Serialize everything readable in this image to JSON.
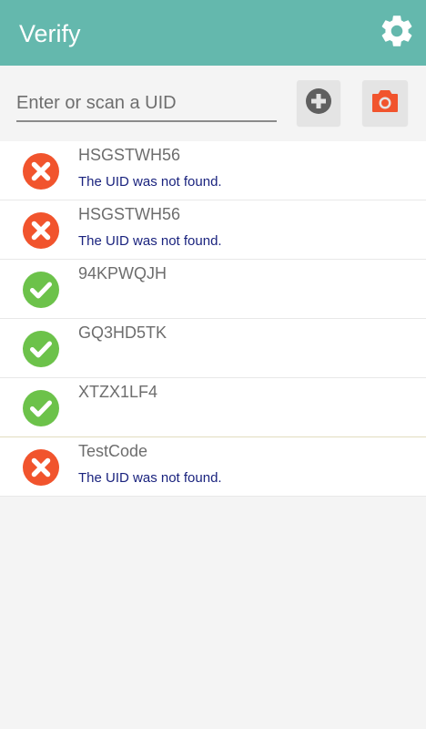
{
  "app": {
    "title": "Verify",
    "accent_color": "#64b8ad",
    "settings_icon": "gear-icon"
  },
  "input": {
    "placeholder": "Enter or scan a UID",
    "value": "",
    "add_icon": "plus-circle-icon",
    "camera_icon": "camera-icon"
  },
  "colors": {
    "error": "#f1542d",
    "success": "#6cc24a",
    "message": "#1a237e"
  },
  "results": [
    {
      "uid": "HSGSTWH56",
      "status": "error",
      "message": "The UID was not found."
    },
    {
      "uid": "HSGSTWH56",
      "status": "error",
      "message": "The UID was not found."
    },
    {
      "uid": "94KPWQJH",
      "status": "success",
      "message": ""
    },
    {
      "uid": "GQ3HD5TK",
      "status": "success",
      "message": ""
    },
    {
      "uid": "XTZX1LF4",
      "status": "success",
      "message": ""
    },
    {
      "uid": "TestCode",
      "status": "error",
      "message": "The UID was not found."
    }
  ]
}
